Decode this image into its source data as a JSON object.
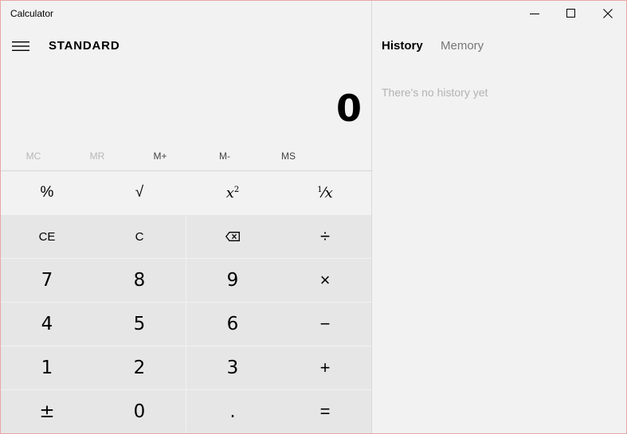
{
  "window": {
    "title": "Calculator"
  },
  "header": {
    "mode": "STANDARD"
  },
  "display": {
    "value": "0"
  },
  "memory": {
    "buttons": [
      {
        "label": "MC",
        "enabled": false
      },
      {
        "label": "MR",
        "enabled": false
      },
      {
        "label": "M+",
        "enabled": true
      },
      {
        "label": "M-",
        "enabled": true
      },
      {
        "label": "MS",
        "enabled": true
      }
    ]
  },
  "keypad": {
    "percent": "%",
    "sqrt": "√",
    "ce": "CE",
    "c": "C",
    "divide": "÷",
    "multiply": "×",
    "minus": "−",
    "plus": "+",
    "equals": "=",
    "negate": "±",
    "decimal": ".",
    "seven": "7",
    "eight": "8",
    "nine": "9",
    "four": "4",
    "five": "5",
    "six": "6",
    "one": "1",
    "two": "2",
    "three": "3",
    "zero": "0"
  },
  "side_panel": {
    "tabs": [
      "History",
      "Memory"
    ],
    "active_tab": "History",
    "empty_message": "There's no history yet"
  },
  "icons": {
    "menu": "hamburger-icon",
    "minimize": "minimize-icon",
    "maximize": "maximize-icon",
    "close": "close-icon",
    "backspace": "backspace-icon",
    "square": "x-squared-icon",
    "reciprocal": "reciprocal-icon"
  },
  "colors": {
    "window_border": "#e8a6a6",
    "panel_bg": "#f2f2f2",
    "key_bg": "#e6e6e6",
    "disabled_text": "#b8b8b8"
  }
}
